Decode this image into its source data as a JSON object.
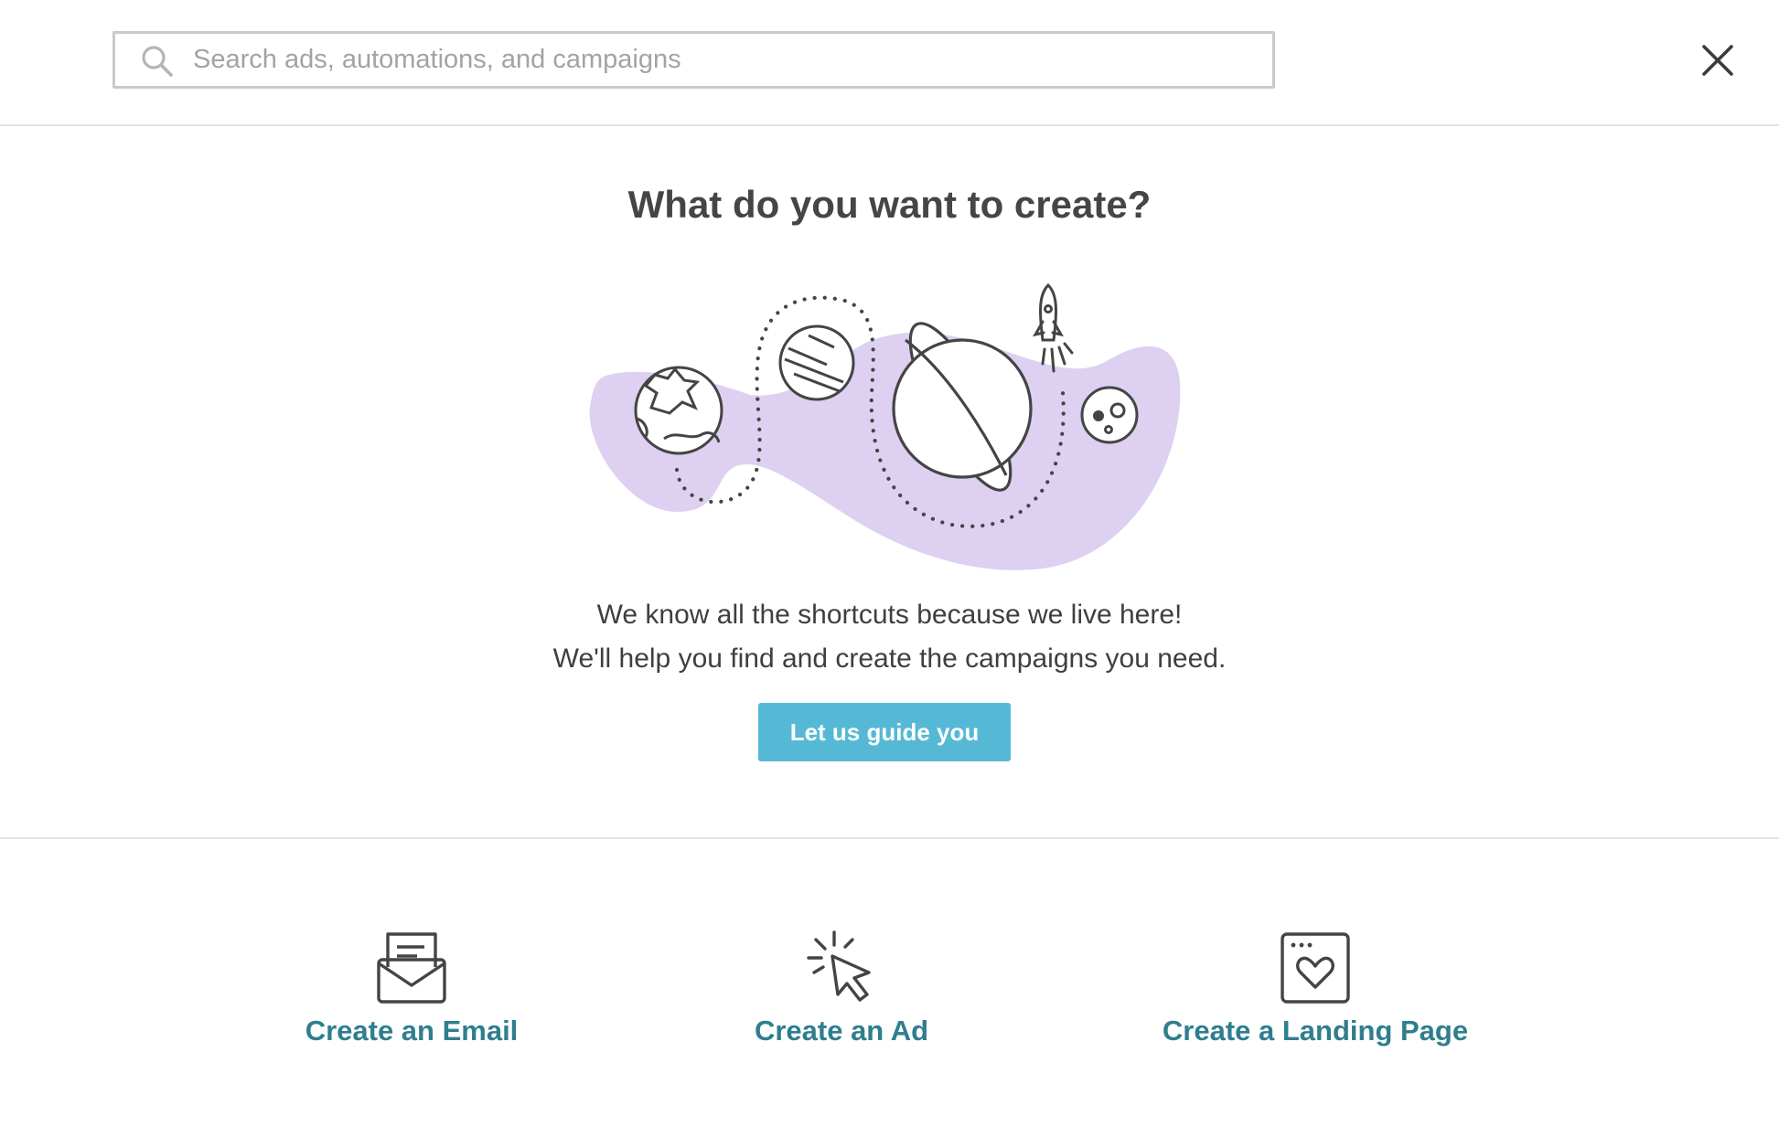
{
  "search": {
    "placeholder": "Search ads, automations, and campaigns",
    "value": ""
  },
  "header": {
    "close_icon": "close-icon"
  },
  "hero": {
    "title": "What do you want to create?",
    "illustration": "space-planets-illustration",
    "line1": "We know all the shortcuts because we live here!",
    "line2": "We'll help you find and create the campaigns you need.",
    "guide_button": "Let us guide you"
  },
  "options": [
    {
      "label": "Create an Email",
      "icon": "envelope-icon"
    },
    {
      "label": "Create an Ad",
      "icon": "cursor-click-icon"
    },
    {
      "label": "Create a Landing Page",
      "icon": "browser-heart-icon"
    }
  ],
  "colors": {
    "accent_button": "#55b9d6",
    "link_text": "#2f7e8e",
    "blob": "#ddd0f1",
    "line_art": "#444444"
  }
}
